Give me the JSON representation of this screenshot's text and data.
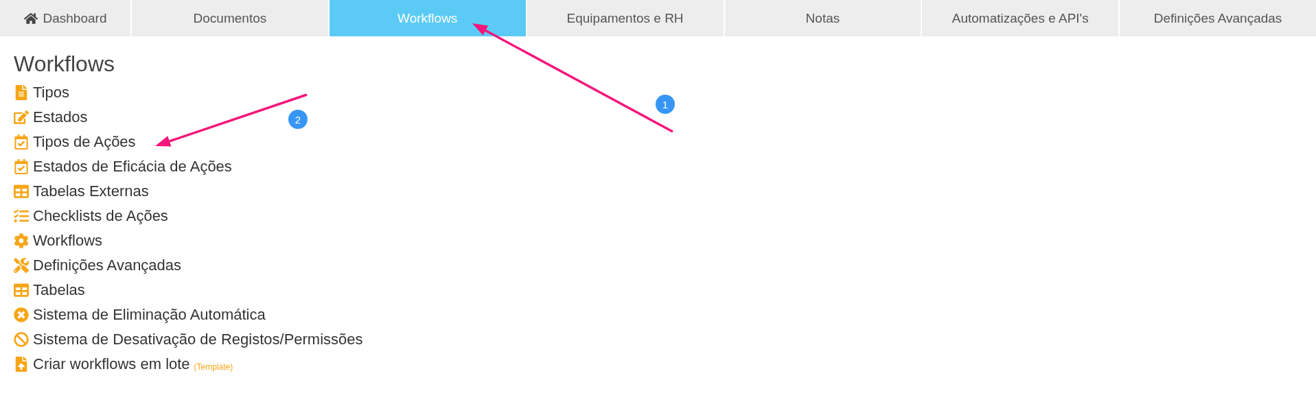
{
  "tabs": [
    {
      "label": "Dashboard",
      "selected": false
    },
    {
      "label": "Documentos",
      "selected": false
    },
    {
      "label": "Workflows",
      "selected": true
    },
    {
      "label": "Equipamentos e RH",
      "selected": false
    },
    {
      "label": "Notas",
      "selected": false
    },
    {
      "label": "Automatizações e API's",
      "selected": false
    },
    {
      "label": "Definições Avançadas",
      "selected": false
    }
  ],
  "page_title": "Workflows",
  "links": [
    {
      "label": "Tipos"
    },
    {
      "label": "Estados"
    },
    {
      "label": "Tipos de Ações"
    },
    {
      "label": "Estados de Eficácia de Ações"
    },
    {
      "label": "Tabelas Externas"
    },
    {
      "label": "Checklists de Ações"
    },
    {
      "label": "Workflows"
    },
    {
      "label": "Definições Avançadas"
    },
    {
      "label": "Tabelas"
    },
    {
      "label": "Sistema de Eliminação Automática"
    },
    {
      "label": "Sistema de Desativação de Registos/Permissões"
    },
    {
      "label": "Criar workflows em lote",
      "note": "(Template)"
    }
  ],
  "annotations": [
    {
      "number": "1"
    },
    {
      "number": "2"
    }
  ]
}
